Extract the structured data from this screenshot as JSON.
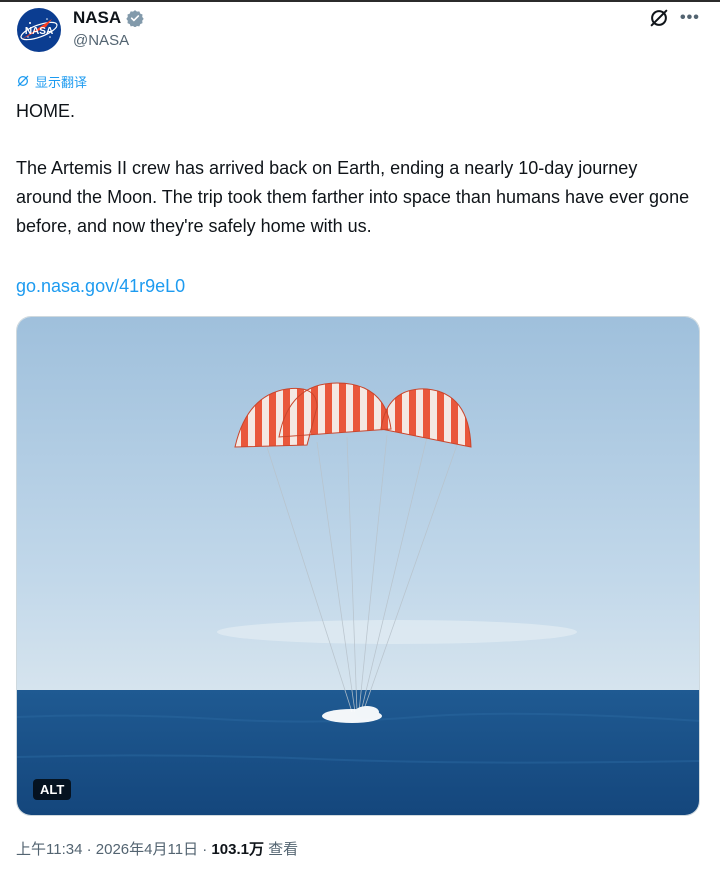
{
  "author": {
    "name": "NASA",
    "handle": "@NASA",
    "avatar_text": "NASA",
    "verified_icon": "verified-badge-icon"
  },
  "header_icons": {
    "grok": "grok-icon",
    "more": "more-icon"
  },
  "translate": {
    "label": "显示翻译",
    "icon": "translate-icon"
  },
  "tweet": {
    "headline": "HOME.",
    "body": "The Artemis II crew has arrived back on Earth, ending a nearly 10-day journey around the Moon. The trip took them farther into space than humans have ever gone before, and now they're safely home with us.",
    "link": "go.nasa.gov/41r9eL0"
  },
  "media": {
    "alt_label": "ALT"
  },
  "meta": {
    "time": "上午11:34",
    "separator": " · ",
    "date": "2026年4月11日",
    "views_count": "103.1万",
    "views_label": " 查看"
  },
  "colors": {
    "accent": "#1d9bf0",
    "text": "#0f1419",
    "muted": "#536471"
  }
}
